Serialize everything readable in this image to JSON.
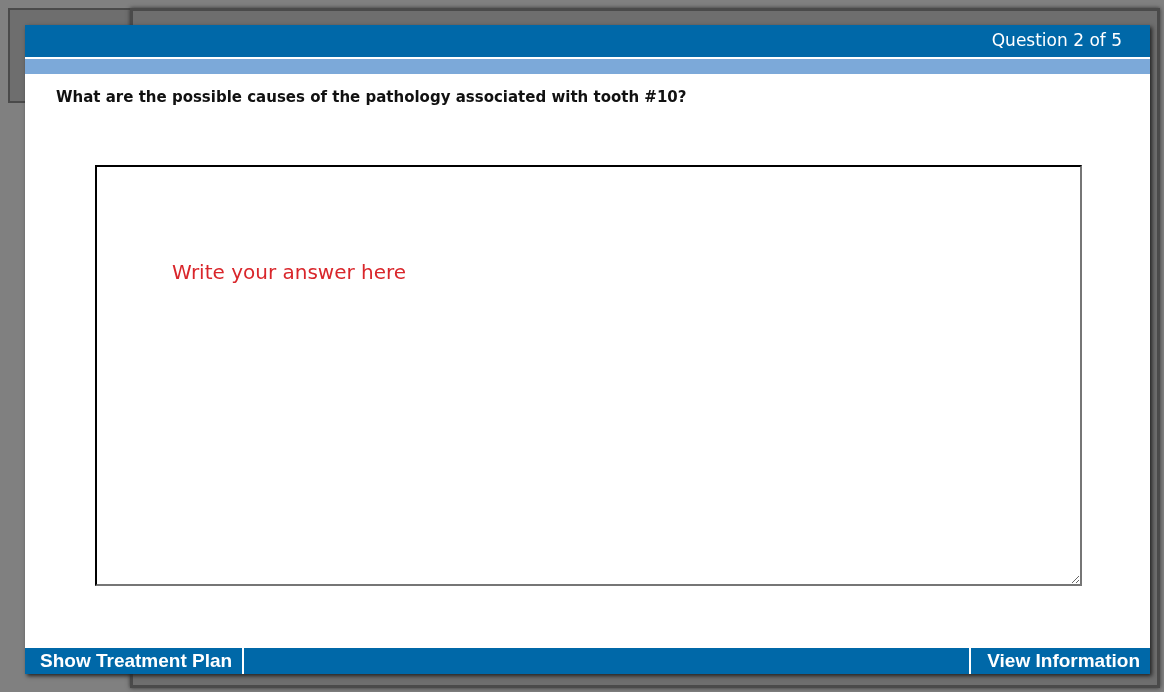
{
  "dialog": {
    "counter": "Question 2 of 5",
    "question": "What are the possible causes of the pathology associated with tooth #10?",
    "answer": {
      "placeholder": "Write your answer here"
    },
    "footer": {
      "left_button": "Show Treatment Plan",
      "right_button": "View Information"
    }
  }
}
